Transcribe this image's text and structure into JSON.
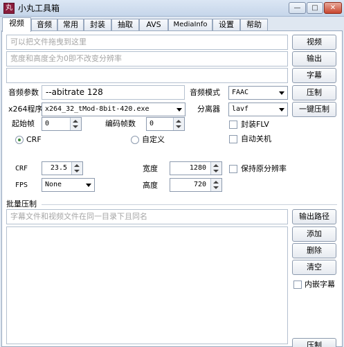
{
  "window": {
    "icon_label": "丸",
    "title": "小丸工具箱",
    "controls": {
      "minimize": "—",
      "maximize": "□",
      "close": "✕"
    }
  },
  "tabs": [
    "视频",
    "音频",
    "常用",
    "封装",
    "抽取",
    "AVS",
    "MediaInfo",
    "设置",
    "帮助"
  ],
  "video": {
    "video_file_placeholder": "可以把文件拖曳到这里",
    "output_placeholder": "宽度和高度全为0即不改变分辨率",
    "subtitle_value": "",
    "buttons": {
      "video": "视频",
      "output": "输出",
      "subtitle": "字幕",
      "compress": "压制",
      "one_click": "一键压制"
    },
    "audio_params_label": "音频参数",
    "audio_params_value": "--abitrate 128",
    "audio_mode_label": "音频模式",
    "audio_mode_value": "FAAC",
    "x264_label": "x264程序",
    "x264_value": "x264_32_tMod-8bit-420.exe",
    "splitter_label": "分离器",
    "splitter_value": "lavf",
    "start_frame_label": "起始帧",
    "start_frame_value": "0",
    "encode_frames_label": "编码帧数",
    "encode_frames_value": "0",
    "mux_flv_label": "封装FLV",
    "auto_shutdown_label": "自动关机",
    "crf_radio_label": "CRF",
    "custom_radio_label": "自定义",
    "crf_label": "CRF",
    "crf_value": "23.5",
    "width_label": "宽度",
    "width_value": "1280",
    "keep_res_label": "保持原分辨率",
    "fps_label": "FPS",
    "fps_value": "None",
    "height_label": "高度",
    "height_value": "720"
  },
  "batch": {
    "title": "批量压制",
    "hint_placeholder": "字幕文件和视频文件在同一目录下且同名",
    "buttons": {
      "output_path": "输出路径",
      "add": "添加",
      "delete": "删除",
      "clear": "清空",
      "compress": "压制"
    },
    "embed_subtitle_label": "内嵌字幕"
  }
}
